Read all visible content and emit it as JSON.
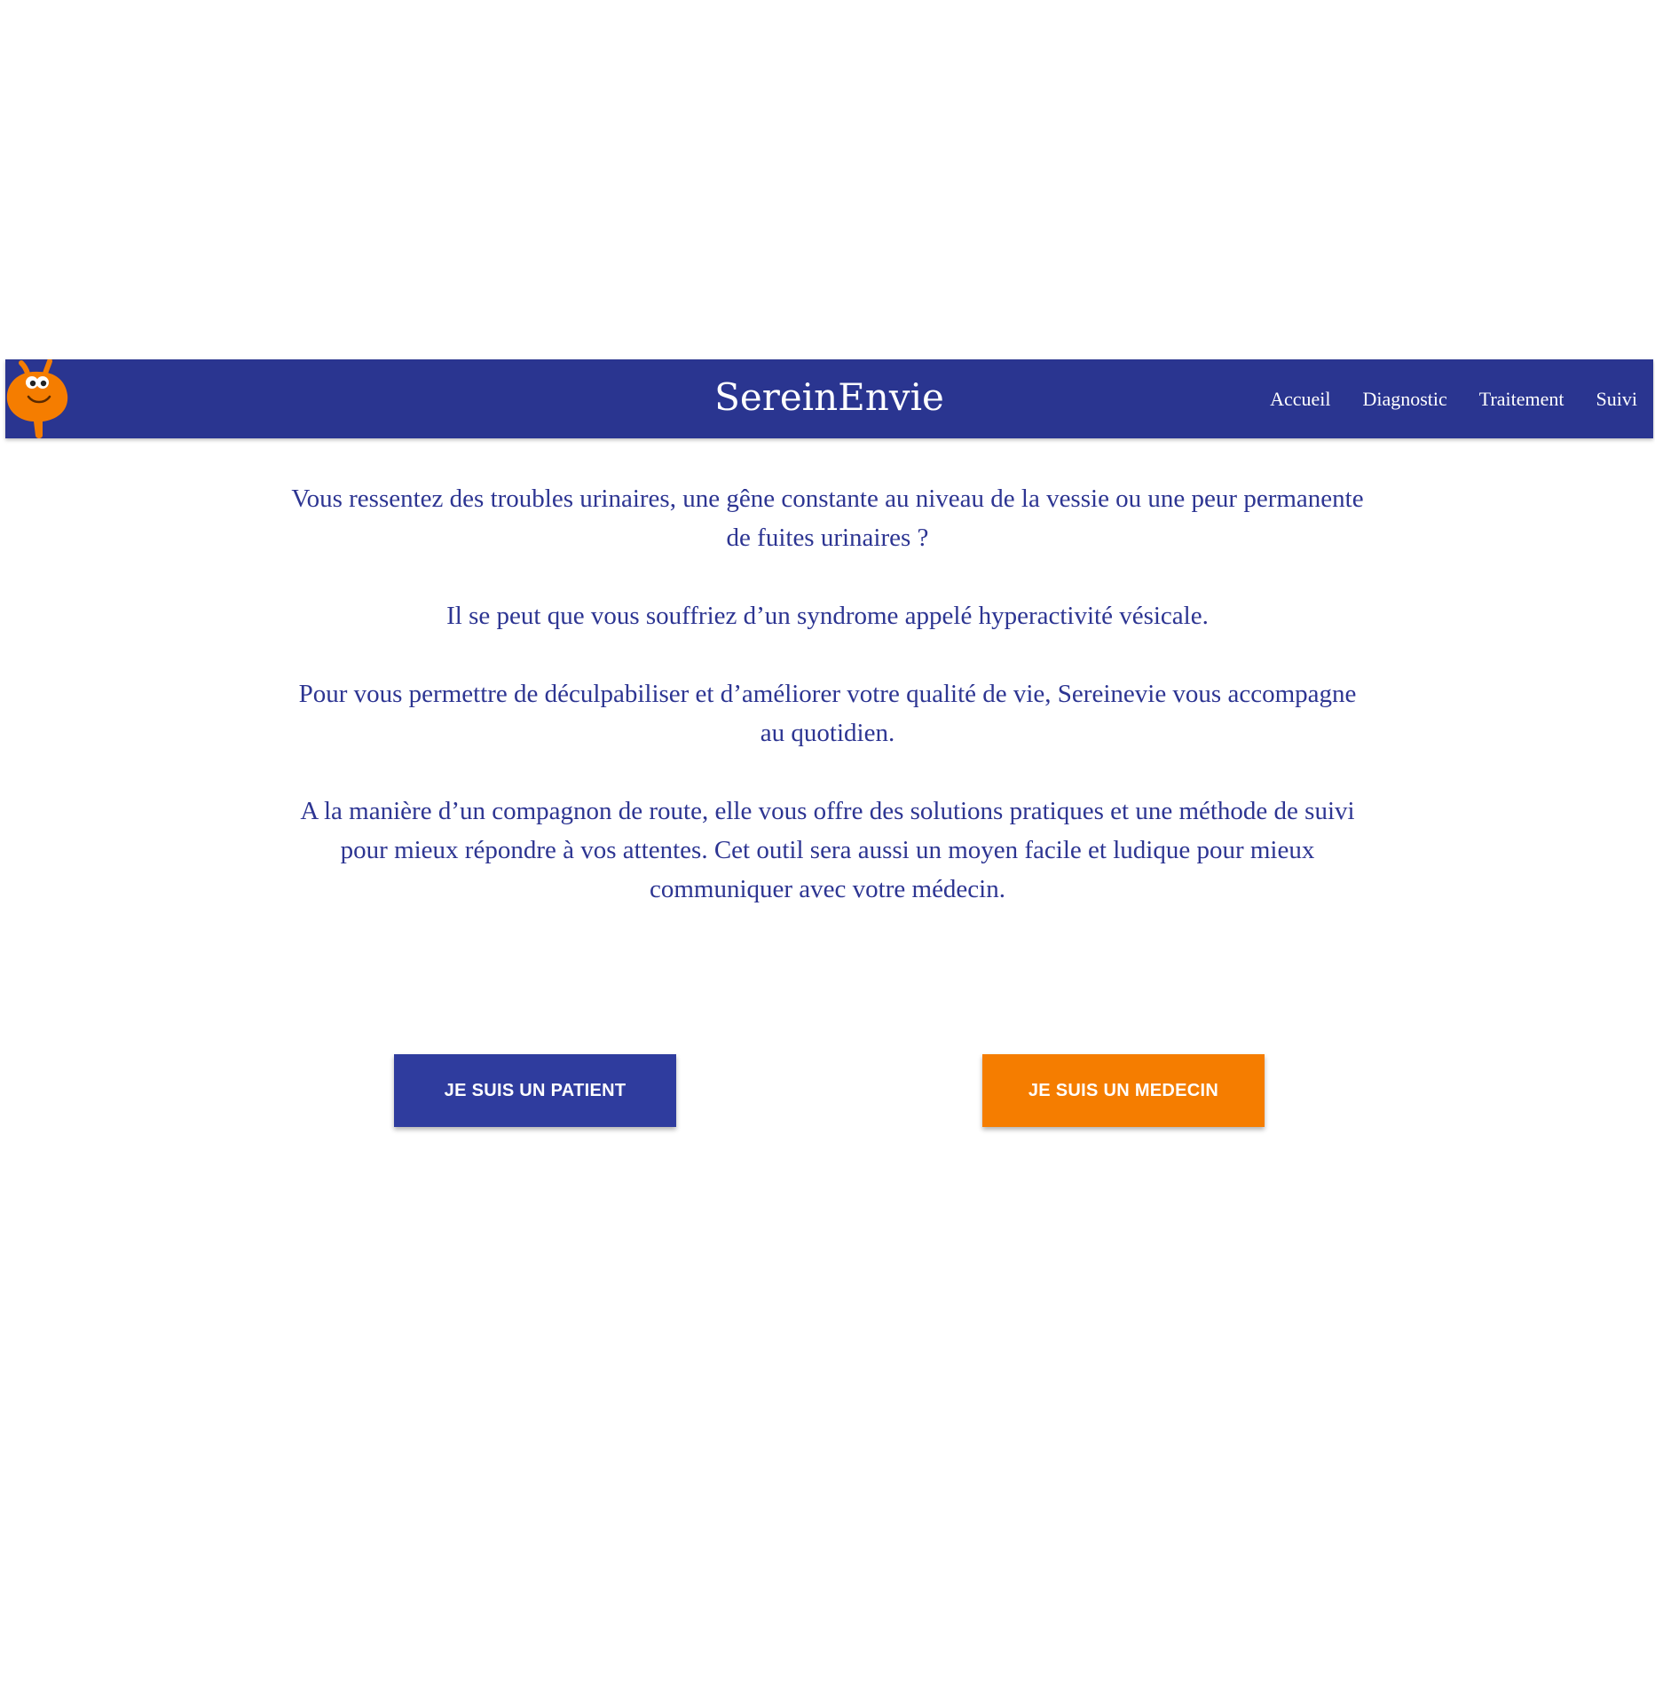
{
  "header": {
    "brand": "SereinEnvie",
    "logo_icon": "orange-bladder-mascot-icon",
    "nav": [
      {
        "label": "Accueil"
      },
      {
        "label": "Diagnostic"
      },
      {
        "label": "Traitement"
      },
      {
        "label": "Suivi"
      }
    ]
  },
  "intro": {
    "paragraphs": [
      "Vous ressentez des troubles urinaires, une gêne constante au niveau de la vessie ou une peur permanente de fuites urinaires ?",
      "Il se peut que vous souffriez d’un syndrome appelé hyperactivité vésicale.",
      "Pour vous permettre de déculpabiliser et d’améliorer votre qualité de vie, Sereinevie vous accompagne au quotidien.",
      "A la manière d’un compagnon de route, elle vous offre des solutions pratiques et une méthode de suivi pour mieux répondre à vos attentes. Cet outil sera aussi un moyen facile et ludique pour mieux communiquer avec votre médecin."
    ]
  },
  "actions": {
    "patient_label": "JE SUIS UN PATIENT",
    "medecin_label": "JE SUIS UN MEDECIN"
  },
  "colors": {
    "primary": "#2a3590",
    "accent": "#f57d00",
    "text": "#2d3592"
  }
}
